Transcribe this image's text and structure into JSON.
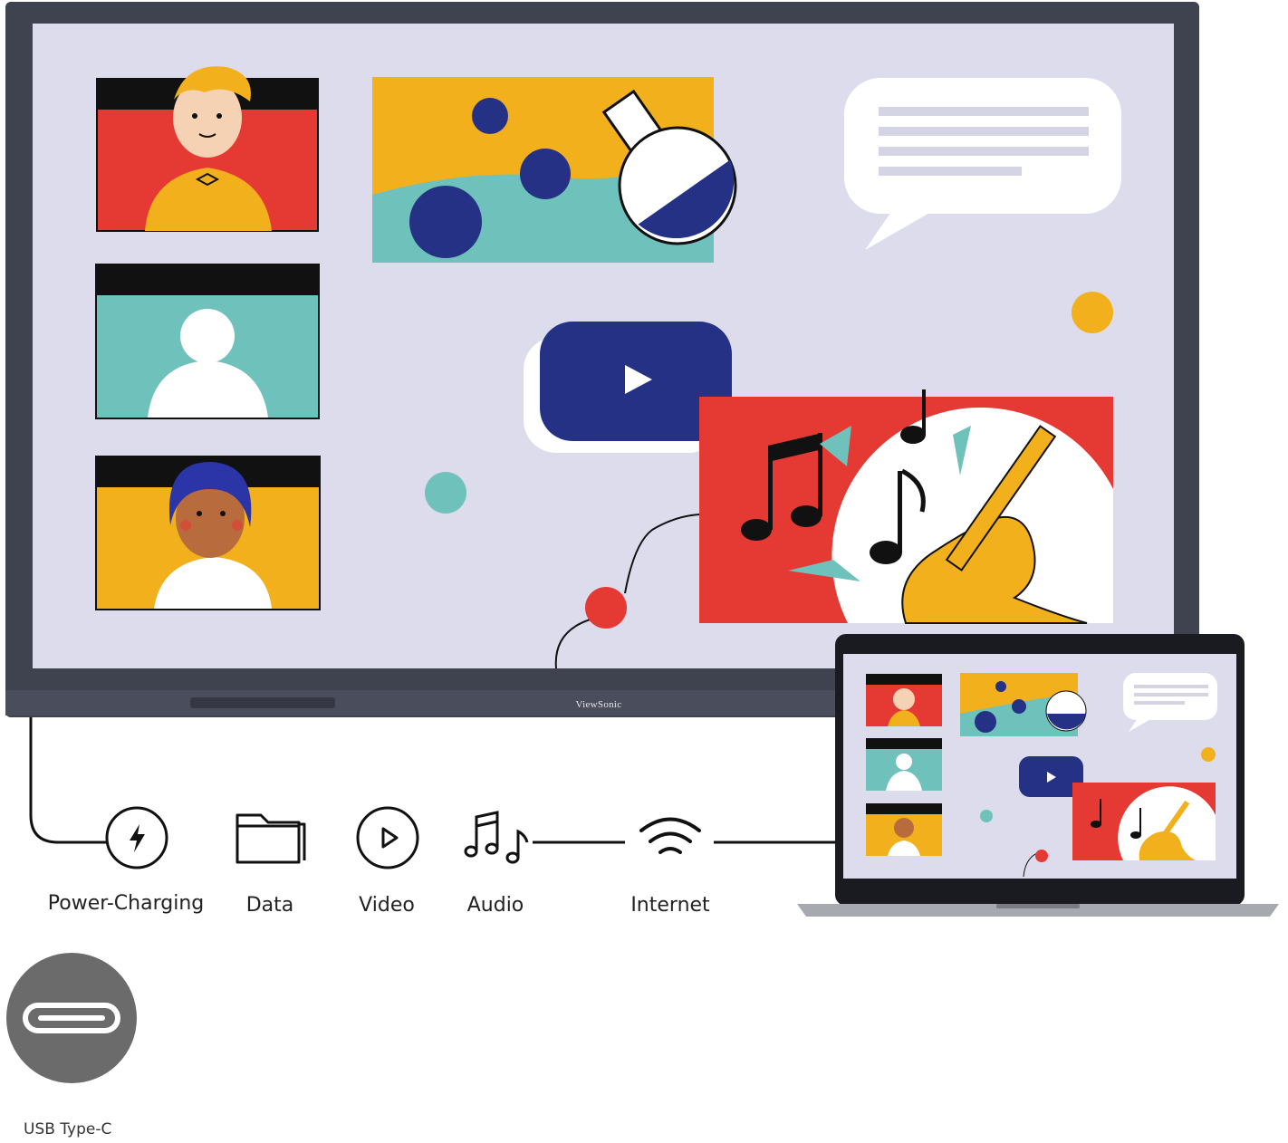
{
  "brand": "ViewSonic",
  "features": [
    {
      "label": "Power-Charging",
      "icon": "lightning-icon"
    },
    {
      "label": "Data",
      "icon": "folder-icon"
    },
    {
      "label": "Video",
      "icon": "play-circle-icon"
    },
    {
      "label": "Audio",
      "icon": "music-notes-icon"
    },
    {
      "label": "Internet",
      "icon": "wifi-icon"
    }
  ],
  "connector": {
    "label": "USB Type-C",
    "icon": "usb-c-icon"
  },
  "colors": {
    "screen_bg": "#dcdced",
    "bezel": "#3f4350",
    "red": "#e53a34",
    "yellow": "#f2b01d",
    "teal": "#6fc2bb",
    "navy": "#243184",
    "usb_badge": "#6b6b6b"
  }
}
